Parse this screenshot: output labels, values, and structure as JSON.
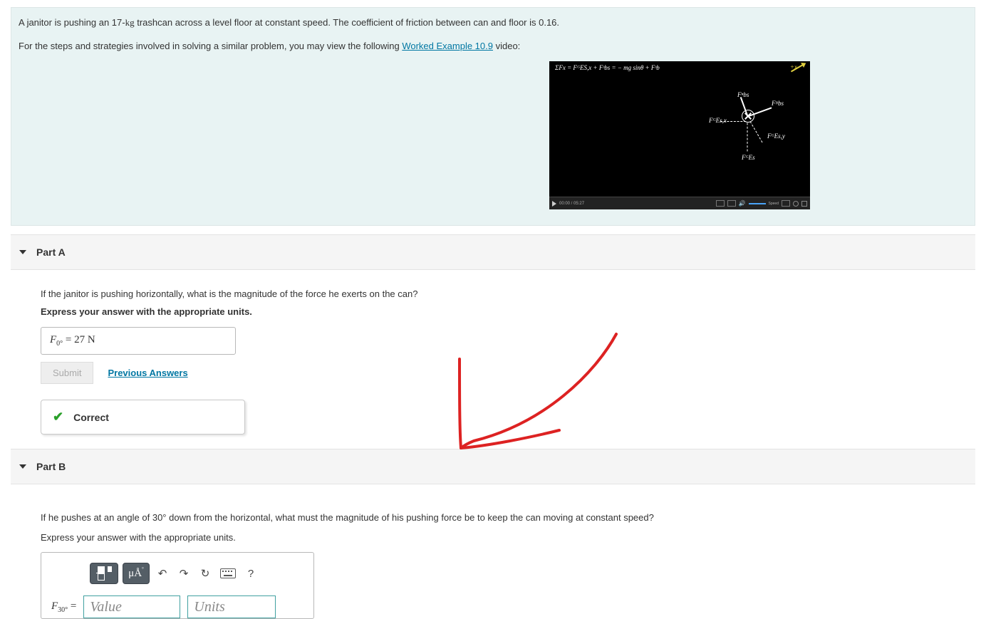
{
  "problem": {
    "text_before_mass": "A janitor is pushing an 17-",
    "mass_unit": "kg",
    "text_after_mass": " trashcan across a level floor at constant speed. The coefficient of friction between can and floor is 0.16.",
    "strategy_text_before_link": "For the steps and strategies involved in solving a similar problem, you may view the following ",
    "worked_example_link": "Worked Example 10.9",
    "strategy_text_after_link": " video:",
    "video": {
      "formula": "ΣFx =  FᴳES,x + Fˢbs = − mg sinθ + Fˢb",
      "plus_x": "+x",
      "labels": {
        "Fnbs": "Fⁿbs",
        "Ffsbs": "Fᶠˢbs",
        "FGEsx": "FᴳEs,x",
        "FGEsy": "FᴳEs,y",
        "FGEs": "FᴳEs"
      },
      "time": "00:00 / 05:27",
      "speed_label": "Speed"
    }
  },
  "partA": {
    "title": "Part A",
    "question": "If the janitor is pushing horizontally, what is the magnitude of the force he exerts on the can?",
    "instruction": "Express your answer with the appropriate units.",
    "answer_var_html": "F",
    "answer_sub": "0°",
    "answer_eq": " = ",
    "answer_val": "27 ",
    "answer_unit": "N",
    "submit_label": "Submit",
    "previous_answers_label": "Previous Answers",
    "correct_label": "Correct"
  },
  "partB": {
    "title": "Part B",
    "question": "If he pushes at an angle of 30°  down from the horizontal, what must the magnitude of his pushing force be to keep the can moving at constant speed?",
    "instruction": "Express your answer with the appropriate units.",
    "toolbar": {
      "units_btn": "μÅ",
      "undo": "↶",
      "redo": "↷",
      "reset": "↻",
      "help": "?"
    },
    "var_label": "F",
    "var_sub": "30°",
    "eq": " = ",
    "value_placeholder": "Value",
    "units_placeholder": "Units"
  }
}
